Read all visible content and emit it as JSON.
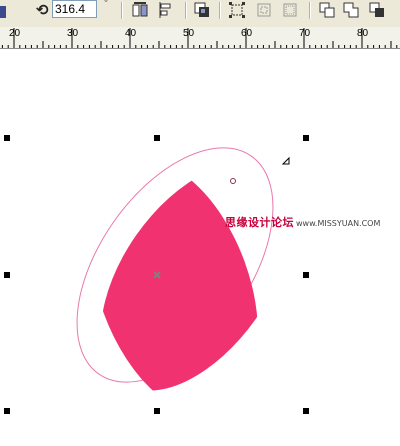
{
  "toolbar": {
    "angle_value": "316.4",
    "angle_unit": "°",
    "buttons": [
      "mirror-icon",
      "align-icon",
      "order-icon",
      "group-icon",
      "ungroup-icon",
      "ungroup-all-icon",
      "combine-icon",
      "weld-icon",
      "trim-icon"
    ]
  },
  "ruler": {
    "labels": [
      "20",
      "30",
      "40",
      "50",
      "60",
      "70",
      "80"
    ]
  },
  "canvas": {
    "shape_fill": "#f03271",
    "outline_color": "#e878ad",
    "center_marker_color": "#808080"
  },
  "watermark": {
    "cn": "思缘设计论坛",
    "url": "www.MISSYUAN.COM"
  }
}
